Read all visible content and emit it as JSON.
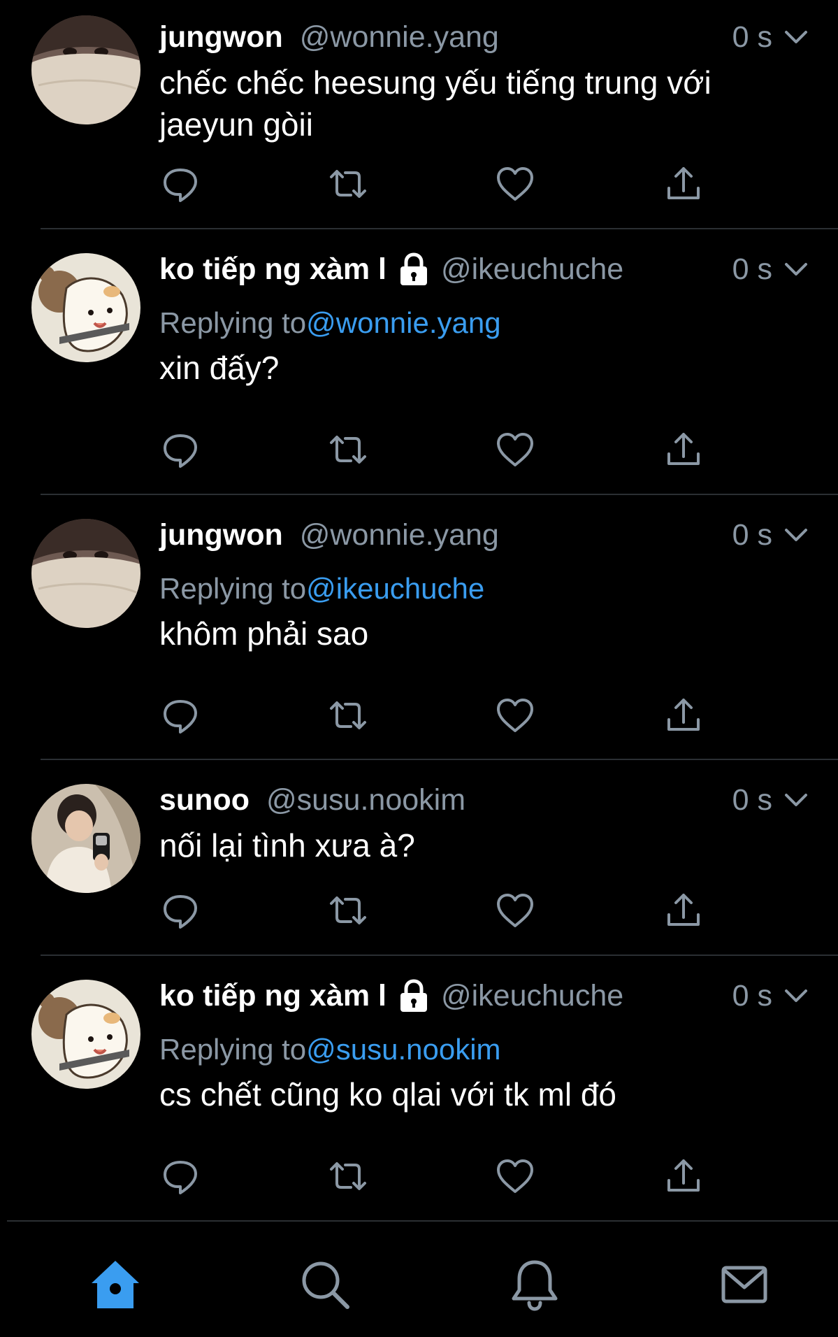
{
  "colors": {
    "background": "#000000",
    "text": "#ffffff",
    "muted": "#8b98a5",
    "accent": "#3a9df0",
    "divider": "#2b2f33"
  },
  "tweets": [
    {
      "name": "jungwon",
      "handle": "@wonnie.yang",
      "time": "0 s",
      "locked": false,
      "avatar": "photo-masked-boy",
      "text": "chếc chếc heesung yếu tiếng trung với jaeyun gòii"
    },
    {
      "name": "ko tiếp ng xàm l",
      "handle": "@ikeuchuche",
      "time": "0 s",
      "locked": true,
      "avatar": "cartoon-dog-bear",
      "replying_prefix": "Replying to",
      "replying_to": "@wonnie.yang",
      "text": "xin đấy?"
    },
    {
      "name": "jungwon",
      "handle": "@wonnie.yang",
      "time": "0 s",
      "locked": false,
      "avatar": "photo-masked-boy",
      "replying_prefix": "Replying to",
      "replying_to": "@ikeuchuche",
      "text": "khôm phải sao"
    },
    {
      "name": "sunoo",
      "handle": "@susu.nookim",
      "time": "0 s",
      "locked": false,
      "avatar": "photo-mirror-selfie",
      "text": "nối lại tình xưa à?"
    },
    {
      "name": "ko tiếp ng xàm l",
      "handle": "@ikeuchuche",
      "time": "0 s",
      "locked": true,
      "avatar": "cartoon-dog-bear",
      "replying_prefix": "Replying to",
      "replying_to": "@susu.nookim",
      "text": "cs chết cũng ko qlai với tk ml đó"
    }
  ],
  "action_icons": [
    "reply-icon",
    "retweet-icon",
    "like-icon",
    "share-icon"
  ],
  "tab_bar": [
    "home-icon",
    "search-icon",
    "notifications-icon",
    "messages-icon"
  ]
}
